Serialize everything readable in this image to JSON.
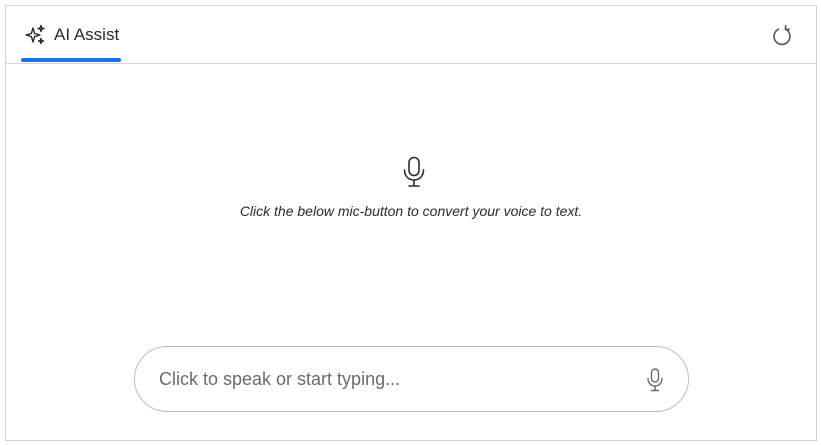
{
  "tab": {
    "label": "AI Assist",
    "icon": "sparkles-icon",
    "indicator_color": "#1a73e8"
  },
  "header": {
    "refresh_icon": "refresh-icon"
  },
  "main": {
    "icon": "microphone-icon",
    "hint": "Click the below mic-button to convert your voice to text."
  },
  "input": {
    "placeholder": "Click to speak or start typing...",
    "value": "",
    "mic_icon": "microphone-icon"
  }
}
